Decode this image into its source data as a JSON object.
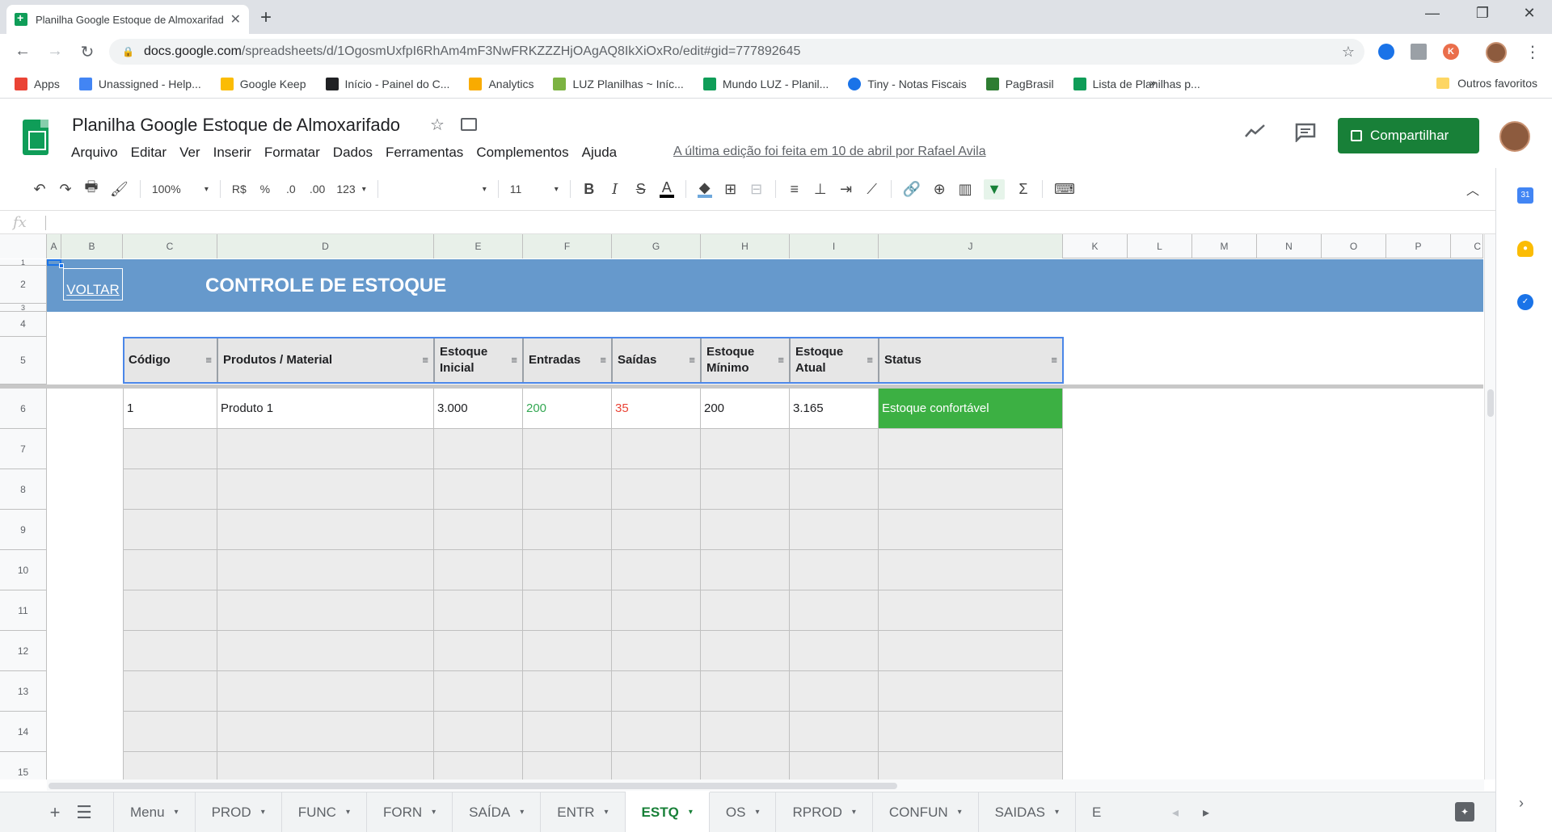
{
  "browser": {
    "tab_title": "Planilha Google Estoque de Almoxarifado",
    "tab_close": "✕",
    "newtab": "+",
    "window_min": "—",
    "window_restore": "❐",
    "window_close": "✕",
    "url_host": "docs.google.com",
    "url_path": "/spreadsheets/d/1OgosmUxfpI6RhAm4mF3NwFRKZZZHjOAgAQ8IkXiOxRo/edit#gid=777892645",
    "nav_back": "←",
    "nav_forward": "→",
    "nav_reload": "↻",
    "lock": "🔒",
    "star": "☆",
    "ext_k": "K",
    "more_menu": "⋮",
    "bookmarks": [
      {
        "label": "Apps",
        "color": "#ea4335"
      },
      {
        "label": "Unassigned - Help...",
        "color": "#4285f4"
      },
      {
        "label": "Google Keep",
        "color": "#fbbc04"
      },
      {
        "label": "Início - Painel do C...",
        "color": "#202124"
      },
      {
        "label": "Analytics",
        "color": "#f9ab00"
      },
      {
        "label": "LUZ Planilhas ~ Iníc...",
        "color": "#7cb342"
      },
      {
        "label": "Mundo LUZ - Planil...",
        "color": "#0f9d58"
      },
      {
        "label": "Tiny - Notas Fiscais",
        "color": "#1a73e8"
      },
      {
        "label": "PagBrasil",
        "color": "#2e7d32"
      },
      {
        "label": "Lista de Planilhas p...",
        "color": "#0f9d58"
      }
    ],
    "bookmarks_more": "»",
    "bookmarks_others": "Outros favoritos"
  },
  "doc": {
    "title": "Planilha Google Estoque de Almoxarifado",
    "menu": [
      "Arquivo",
      "Editar",
      "Ver",
      "Inserir",
      "Formatar",
      "Dados",
      "Ferramentas",
      "Complementos",
      "Ajuda"
    ],
    "last_edit": "A última edição foi feita em 10 de abril por Rafael Avila",
    "share_label": "Compartilhar",
    "activity_icon": "📈",
    "comments_icon": "💬",
    "title_star": "☆"
  },
  "toolbar": {
    "undo": "↶",
    "redo": "↷",
    "print": "🖶",
    "paint": "🖌",
    "zoom": "100%",
    "currency": "R$",
    "percent": "%",
    "dec_less": ".0",
    "dec_more": ".00",
    "format_more": "123",
    "font_family": "",
    "font_size": "11",
    "bold": "B",
    "italic": "I",
    "strike": "S",
    "text_color": "A",
    "fill": "◆",
    "borders": "⊞",
    "merge": "⊟",
    "align_h": "≡",
    "align_v": "⊥",
    "wrap": "⇥",
    "rotate": "⟋",
    "link": "🔗",
    "comment": "⊕",
    "chart": "▥",
    "filter": "▼",
    "functions": "Σ",
    "input_tools": "⌨",
    "collapse": "︿",
    "caret": "▾"
  },
  "formula_bar": {
    "fx": "fx",
    "value": ""
  },
  "grid": {
    "columns": [
      "A",
      "B",
      "C",
      "D",
      "E",
      "F",
      "G",
      "H",
      "I",
      "J",
      "K",
      "L",
      "M",
      "N",
      "O",
      "P",
      "C"
    ],
    "rows": [
      "1",
      "2",
      "3",
      "4",
      "5",
      "6",
      "7",
      "8",
      "9",
      "10",
      "11",
      "12",
      "13",
      "14",
      "15"
    ],
    "voltar": "VOLTAR",
    "banner_title": "CONTROLE DE ESTOQUE",
    "headers": [
      "Código",
      "Produtos / Material",
      "Estoque Inicial",
      "Entradas",
      "Saídas",
      "Estoque Mínimo",
      "Estoque Atual",
      "Status"
    ],
    "filter_glyph": "≡",
    "data_rows": [
      {
        "codigo": "1",
        "produto": "Produto 1",
        "estoque_inicial": "3.000",
        "entradas": "200",
        "saidas": "35",
        "estoque_minimo": "200",
        "estoque_atual": "3.165",
        "status": "Estoque confortável"
      }
    ],
    "colors": {
      "entradas": "#34a853",
      "saidas": "#ea4335",
      "status_ok": "#3cb043",
      "banner": "#6699cc"
    }
  },
  "sheet_tabs": {
    "add": "+",
    "all_sheets": "☰",
    "tabs": [
      "Menu",
      "PROD",
      "FUNC",
      "FORN",
      "SAÍDA",
      "ENTR",
      "ESTQ",
      "OS",
      "RPROD",
      "CONFUN",
      "SAIDAS",
      "E"
    ],
    "active": "ESTQ",
    "caret": "▾",
    "scroll_left": "◂",
    "scroll_right": "▸",
    "explore": "✦"
  },
  "side_panel": {
    "calendar": "31",
    "keep": "●",
    "tasks": "✓",
    "expand": "›"
  }
}
